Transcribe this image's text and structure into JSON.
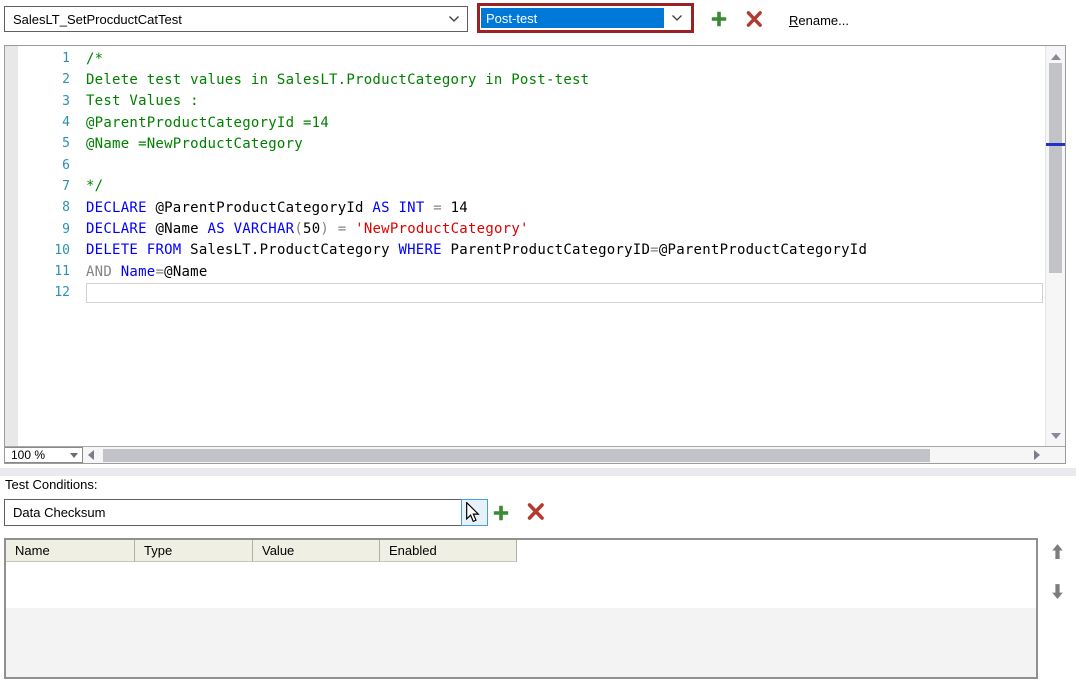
{
  "top_bar": {
    "test_combo": {
      "value": "SalesLT_SetProcductCatTest"
    },
    "phase_combo": {
      "value": "Post-test"
    },
    "rename_label": "Rename..."
  },
  "editor": {
    "zoom_level": "100 %",
    "active_line": 12,
    "lines": [
      {
        "n": "1",
        "seg": [
          [
            "c",
            "/*"
          ]
        ]
      },
      {
        "n": "2",
        "seg": [
          [
            "c",
            "Delete test values in SalesLT.ProductCategory in Post-test"
          ]
        ]
      },
      {
        "n": "3",
        "seg": [
          [
            "c",
            "Test Values :"
          ]
        ]
      },
      {
        "n": "4",
        "seg": [
          [
            "c",
            "@ParentProductCategoryId =14"
          ]
        ]
      },
      {
        "n": "5",
        "seg": [
          [
            "c",
            "@Name =NewProductCategory"
          ]
        ]
      },
      {
        "n": "6",
        "seg": []
      },
      {
        "n": "7",
        "seg": [
          [
            "c",
            "*/"
          ]
        ]
      },
      {
        "n": "8",
        "seg": [
          [
            "k",
            "DECLARE"
          ],
          [
            "d",
            " @ParentProductCategoryId "
          ],
          [
            "k",
            "AS"
          ],
          [
            "d",
            " "
          ],
          [
            "k",
            "INT"
          ],
          [
            "d",
            " "
          ],
          [
            "o",
            "="
          ],
          [
            "d",
            " 14"
          ]
        ]
      },
      {
        "n": "9",
        "seg": [
          [
            "k",
            "DECLARE"
          ],
          [
            "d",
            " @Name "
          ],
          [
            "k",
            "AS"
          ],
          [
            "d",
            " "
          ],
          [
            "k",
            "VARCHAR"
          ],
          [
            "o",
            "("
          ],
          [
            "d",
            "50"
          ],
          [
            "o",
            ")"
          ],
          [
            "d",
            " "
          ],
          [
            "o",
            "="
          ],
          [
            "d",
            " "
          ],
          [
            "s",
            "'NewProductCategory'"
          ]
        ]
      },
      {
        "n": "10",
        "seg": [
          [
            "k",
            "DELETE"
          ],
          [
            "d",
            " "
          ],
          [
            "k",
            "FROM"
          ],
          [
            "d",
            " SalesLT.ProductCategory "
          ],
          [
            "k",
            "WHERE"
          ],
          [
            "d",
            " ParentProductCategoryID"
          ],
          [
            "o",
            "="
          ],
          [
            "d",
            "@ParentProductCategoryId"
          ]
        ]
      },
      {
        "n": "11",
        "seg": [
          [
            "o",
            "AND"
          ],
          [
            "d",
            " "
          ],
          [
            "k",
            "Name"
          ],
          [
            "o",
            "="
          ],
          [
            "d",
            "@Name"
          ]
        ]
      },
      {
        "n": "12",
        "seg": []
      }
    ]
  },
  "test_conditions": {
    "label": "Test Conditions:",
    "condition_combo": {
      "value": "Data Checksum"
    },
    "grid": {
      "columns": [
        "Name",
        "Type",
        "Value",
        "Enabled"
      ],
      "rows": []
    }
  },
  "icons": {
    "add": "plus-icon",
    "delete": "red-x-icon",
    "dropdown": "chevron-down-icon",
    "scroll_up": "triangle-up-icon",
    "scroll_down": "triangle-down-icon",
    "scroll_left": "triangle-left-icon",
    "scroll_right": "triangle-right-icon",
    "move_up": "arrow-up-icon",
    "move_down": "arrow-down-icon",
    "pointer": "mouse-cursor-icon"
  },
  "colors": {
    "selection_blue": "#0078d7",
    "keyword_blue": "#0000ff",
    "comment_green": "#008000",
    "string_red": "#e00000",
    "operator_gray": "#848484",
    "line_number_teal": "#2b91af",
    "add_green": "#388a34",
    "delete_red": "#b23a2e",
    "focus_border_red": "#9b2125",
    "grid_header_beige": "#f0efe3"
  }
}
